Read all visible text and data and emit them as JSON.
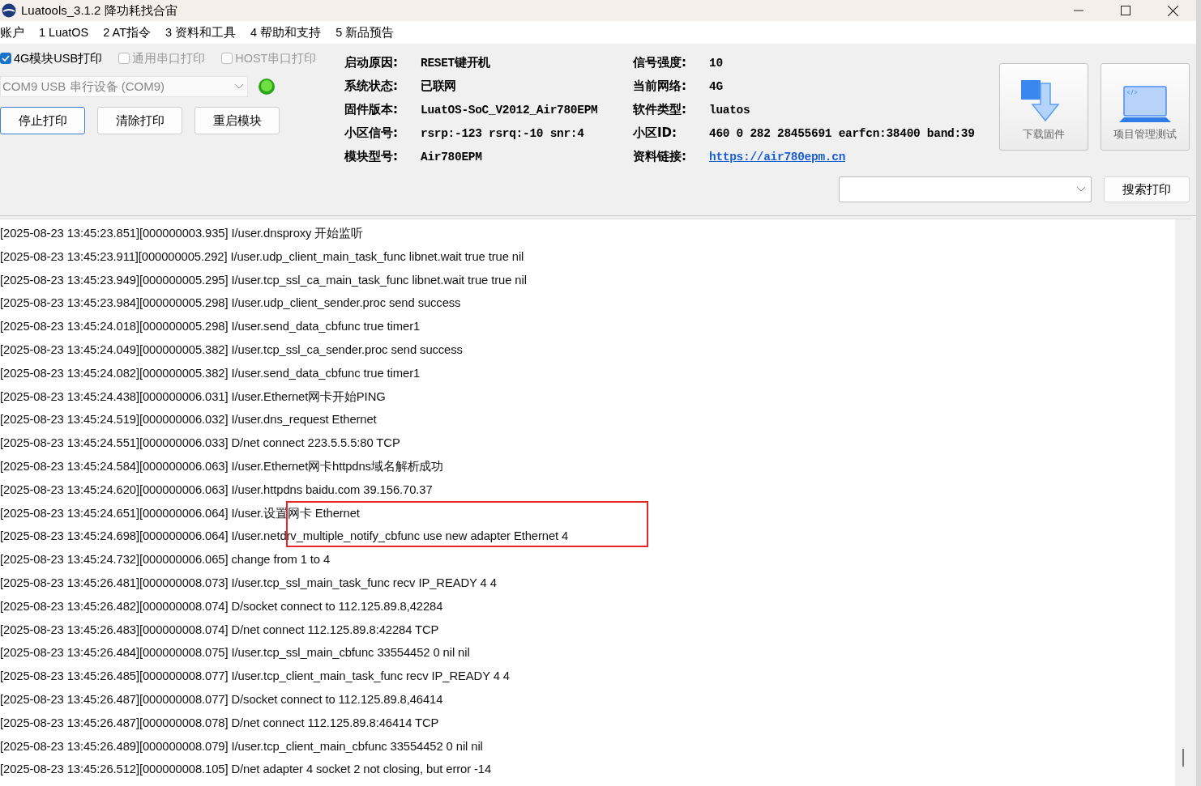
{
  "window": {
    "title": "Luatools_3.1.2 降功耗找合宙"
  },
  "menu": [
    "账户",
    "1 LuatOS",
    "2 AT指令",
    "3 资料和工具",
    "4 帮助和支持",
    "5 新品预告"
  ],
  "print_options": [
    {
      "label": "4G模块USB打印",
      "checked": true,
      "disabled": false
    },
    {
      "label": "通用串口打印",
      "checked": false,
      "disabled": true
    },
    {
      "label": "HOST串口打印",
      "checked": false,
      "disabled": true
    }
  ],
  "port_select": {
    "value": "COM9 USB 串行设备 (COM9)"
  },
  "actions": [
    {
      "label": "停止打印",
      "focused": true
    },
    {
      "label": "清除打印",
      "focused": false
    },
    {
      "label": "重启模块",
      "focused": false
    }
  ],
  "info_left": [
    {
      "label": "启动原因:",
      "value": "RESET键开机"
    },
    {
      "label": "系统状态:",
      "value": "已联网"
    },
    {
      "label": "固件版本:",
      "value": "LuatOS-SoC_V2012_Air780EPM"
    },
    {
      "label": "小区信号:",
      "value": "rsrp:-123 rsrq:-10 snr:4"
    },
    {
      "label": "模块型号:",
      "value": "Air780EPM"
    }
  ],
  "info_right": [
    {
      "label": "信号强度:",
      "value": "10",
      "kind": "text"
    },
    {
      "label": "当前网络:",
      "value": "4G",
      "kind": "text"
    },
    {
      "label": "软件类型:",
      "value": "luatos",
      "kind": "text"
    },
    {
      "label": "小区ID:",
      "value": "460 0 282 28455691 earfcn:38400 band:39",
      "kind": "text"
    },
    {
      "label": "资料链接:",
      "value": "https://air780epm.cn",
      "kind": "link"
    }
  ],
  "tools": [
    {
      "label": "下载固件",
      "kind": "download"
    },
    {
      "label": "项目管理测试",
      "kind": "laptop"
    }
  ],
  "search_button": "搜索打印",
  "log": [
    {
      "text": "[2025-08-23 13:45:23.851][000000003.935] I/user.dnsproxy 开始监听",
      "boxed": false
    },
    {
      "text": "[2025-08-23 13:45:23.911][000000005.292] I/user.udp_client_main_task_func libnet.wait true true nil",
      "boxed": false
    },
    {
      "text": "[2025-08-23 13:45:23.949][000000005.295] I/user.tcp_ssl_ca_main_task_func libnet.wait true true nil",
      "boxed": false
    },
    {
      "text": "[2025-08-23 13:45:23.984][000000005.298] I/user.udp_client_sender.proc send success",
      "boxed": false
    },
    {
      "text": "[2025-08-23 13:45:24.018][000000005.298] I/user.send_data_cbfunc true timer1",
      "boxed": false
    },
    {
      "text": "[2025-08-23 13:45:24.049][000000005.382] I/user.tcp_ssl_ca_sender.proc send success",
      "boxed": false
    },
    {
      "text": "[2025-08-23 13:45:24.082][000000005.382] I/user.send_data_cbfunc true timer1",
      "boxed": false
    },
    {
      "text": "[2025-08-23 13:45:24.438][000000006.031] I/user.Ethernet网卡开始PING",
      "boxed": false
    },
    {
      "text": "[2025-08-23 13:45:24.519][000000006.032] I/user.dns_request Ethernet",
      "boxed": false
    },
    {
      "text": "[2025-08-23 13:45:24.551][000000006.033] D/net connect 223.5.5.5:80 TCP",
      "boxed": false
    },
    {
      "text": "[2025-08-23 13:45:24.584][000000006.063] I/user.Ethernet网卡httpdns域名解析成功",
      "boxed": false
    },
    {
      "text": "[2025-08-23 13:45:24.620][000000006.063] I/user.httpdns baidu.com 39.156.70.37",
      "boxed": false
    },
    {
      "text": "[2025-08-23 13:45:24.651][000000006.064] I/user.设置网卡 Ethernet",
      "boxed": true
    },
    {
      "text": "[2025-08-23 13:45:24.698][000000006.064] I/user.netdrv_multiple_notify_cbfunc use new adapter Ethernet 4",
      "boxed": true
    },
    {
      "text": "[2025-08-23 13:45:24.732][000000006.065] change from 1 to 4",
      "boxed": false
    },
    {
      "text": "[2025-08-23 13:45:26.481][000000008.073] I/user.tcp_ssl_main_task_func recv IP_READY 4 4",
      "boxed": false
    },
    {
      "text": "[2025-08-23 13:45:26.482][000000008.074] D/socket connect to 112.125.89.8,42284",
      "boxed": false
    },
    {
      "text": "[2025-08-23 13:45:26.483][000000008.074] D/net connect 112.125.89.8:42284 TCP",
      "boxed": false
    },
    {
      "text": "[2025-08-23 13:45:26.484][000000008.075] I/user.tcp_ssl_main_cbfunc 33554452 0 nil nil",
      "boxed": false
    },
    {
      "text": "[2025-08-23 13:45:26.485][000000008.077] I/user.tcp_client_main_task_func recv IP_READY 4 4",
      "boxed": false
    },
    {
      "text": "[2025-08-23 13:45:26.487][000000008.077] D/socket connect to 112.125.89.8,46414",
      "boxed": false
    },
    {
      "text": "[2025-08-23 13:45:26.487][000000008.078] D/net connect 112.125.89.8:46414 TCP",
      "boxed": false
    },
    {
      "text": "[2025-08-23 13:45:26.489][000000008.079] I/user.tcp_client_main_cbfunc 33554452 0 nil nil",
      "boxed": false
    },
    {
      "text": "[2025-08-23 13:45:26.512][000000008.105] D/net adapter 4 socket 2 not closing, but error -14",
      "boxed": false
    }
  ]
}
